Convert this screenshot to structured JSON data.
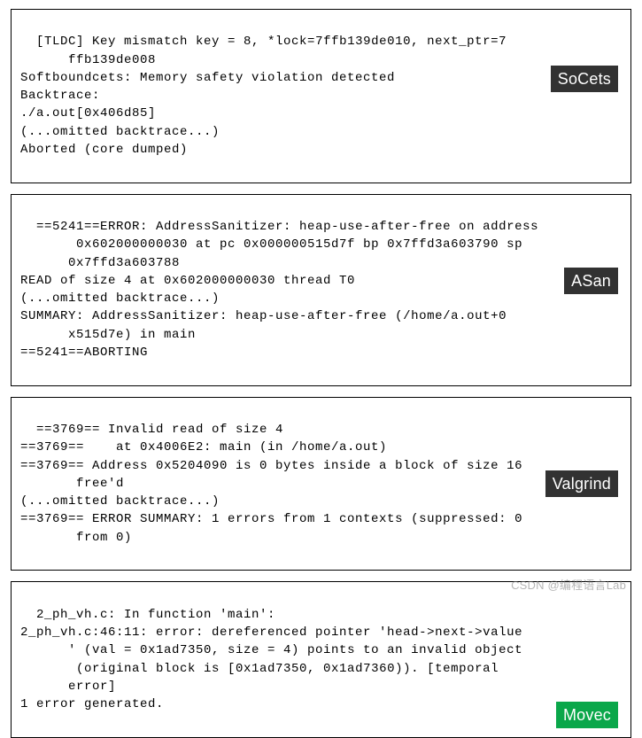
{
  "panels": {
    "socets": {
      "label": "SoCets",
      "text": "[TLDC] Key mismatch key = 8, *lock=7ffb139de010, next_ptr=7\n      ffb139de008\nSoftboundcets: Memory safety violation detected\nBacktrace:\n./a.out[0x406d85]\n(...omitted backtrace...)\nAborted (core dumped)"
    },
    "asan": {
      "label": "ASan",
      "text": "==5241==ERROR: AddressSanitizer: heap-use-after-free on address\n       0x602000000030 at pc 0x000000515d7f bp 0x7ffd3a603790 sp\n      0x7ffd3a603788\nREAD of size 4 at 0x602000000030 thread T0\n(...omitted backtrace...)\nSUMMARY: AddressSanitizer: heap-use-after-free (/home/a.out+0\n      x515d7e) in main\n==5241==ABORTING"
    },
    "valgrind": {
      "label": "Valgrind",
      "text": "==3769== Invalid read of size 4\n==3769==    at 0x4006E2: main (in /home/a.out)\n==3769== Address 0x5204090 is 0 bytes inside a block of size 16\n       free'd\n(...omitted backtrace...)\n==3769== ERROR SUMMARY: 1 errors from 1 contexts (suppressed: 0\n       from 0)"
    },
    "movec": {
      "label": "Movec",
      "text": "2_ph_vh.c: In function 'main':\n2_ph_vh.c:46:11: error: dereferenced pointer 'head->next->value\n      ' (val = 0x1ad7350, size = 4) points to an invalid object\n       (original block is [0x1ad7350, 0x1ad7360)). [temporal\n      error]\n1 error generated."
    }
  },
  "watermark": "CSDN @编程语言Lab"
}
